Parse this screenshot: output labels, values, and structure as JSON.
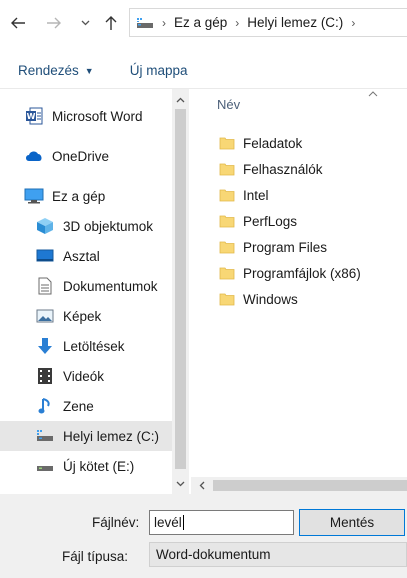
{
  "address_bar": {
    "breadcrumbs": [
      "Ez a gép",
      "Helyi lemez (C:)"
    ],
    "trailing_chevron": "›",
    "back_icon": "arrow-left-icon",
    "forward_icon": "arrow-right-icon",
    "recent_icon": "chevron-down-icon",
    "up_icon": "arrow-up-icon"
  },
  "toolbar": {
    "organize_label": "Rendezés",
    "new_folder_label": "Új mappa"
  },
  "nav": {
    "items": [
      {
        "label": "Microsoft Word",
        "icon": "word-icon"
      },
      {
        "label": "OneDrive",
        "icon": "cloud-icon"
      },
      {
        "label": "Ez a gép",
        "icon": "computer-icon"
      },
      {
        "label": "3D objektumok",
        "icon": "cube-3d-icon"
      },
      {
        "label": "Asztal",
        "icon": "desktop-icon"
      },
      {
        "label": "Dokumentumok",
        "icon": "document-icon"
      },
      {
        "label": "Képek",
        "icon": "pictures-icon"
      },
      {
        "label": "Letöltések",
        "icon": "download-icon"
      },
      {
        "label": "Videók",
        "icon": "video-icon"
      },
      {
        "label": "Zene",
        "icon": "music-icon"
      },
      {
        "label": "Helyi lemez (C:)",
        "icon": "drive-icon",
        "selected": true
      },
      {
        "label": "Új kötet (E:)",
        "icon": "drive-icon"
      }
    ]
  },
  "content": {
    "column_header": "Név",
    "folders": [
      "Feladatok",
      "Felhasználók",
      "Intel",
      "PerfLogs",
      "Program Files",
      "Programfájlok (x86)",
      "Windows"
    ]
  },
  "form": {
    "filename_label": "Fájlnév:",
    "filename_value": "levél",
    "save_label": "Mentés",
    "filetype_label": "Fájl típusa:",
    "filetype_value": "Word-dokumentum"
  },
  "colors": {
    "accent": "#0078d7",
    "link": "#1f4e79",
    "folder": "#f8d775",
    "selected_bg": "#e6e6e6"
  }
}
